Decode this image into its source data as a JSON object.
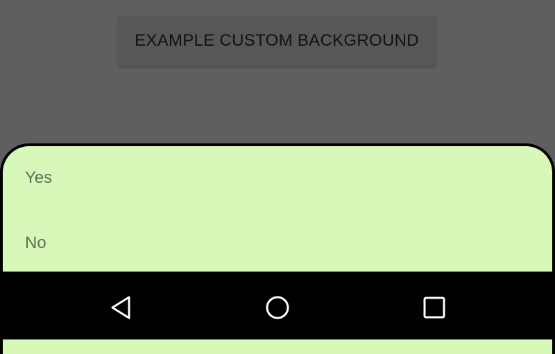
{
  "button": {
    "label": "EXAMPLE CUSTOM BACKGROUND"
  },
  "sheet": {
    "items": [
      {
        "label": "Yes"
      },
      {
        "label": "No"
      }
    ]
  },
  "nav": {
    "back_icon": "back-triangle-icon",
    "home_icon": "home-circle-icon",
    "recents_icon": "recents-square-icon"
  }
}
